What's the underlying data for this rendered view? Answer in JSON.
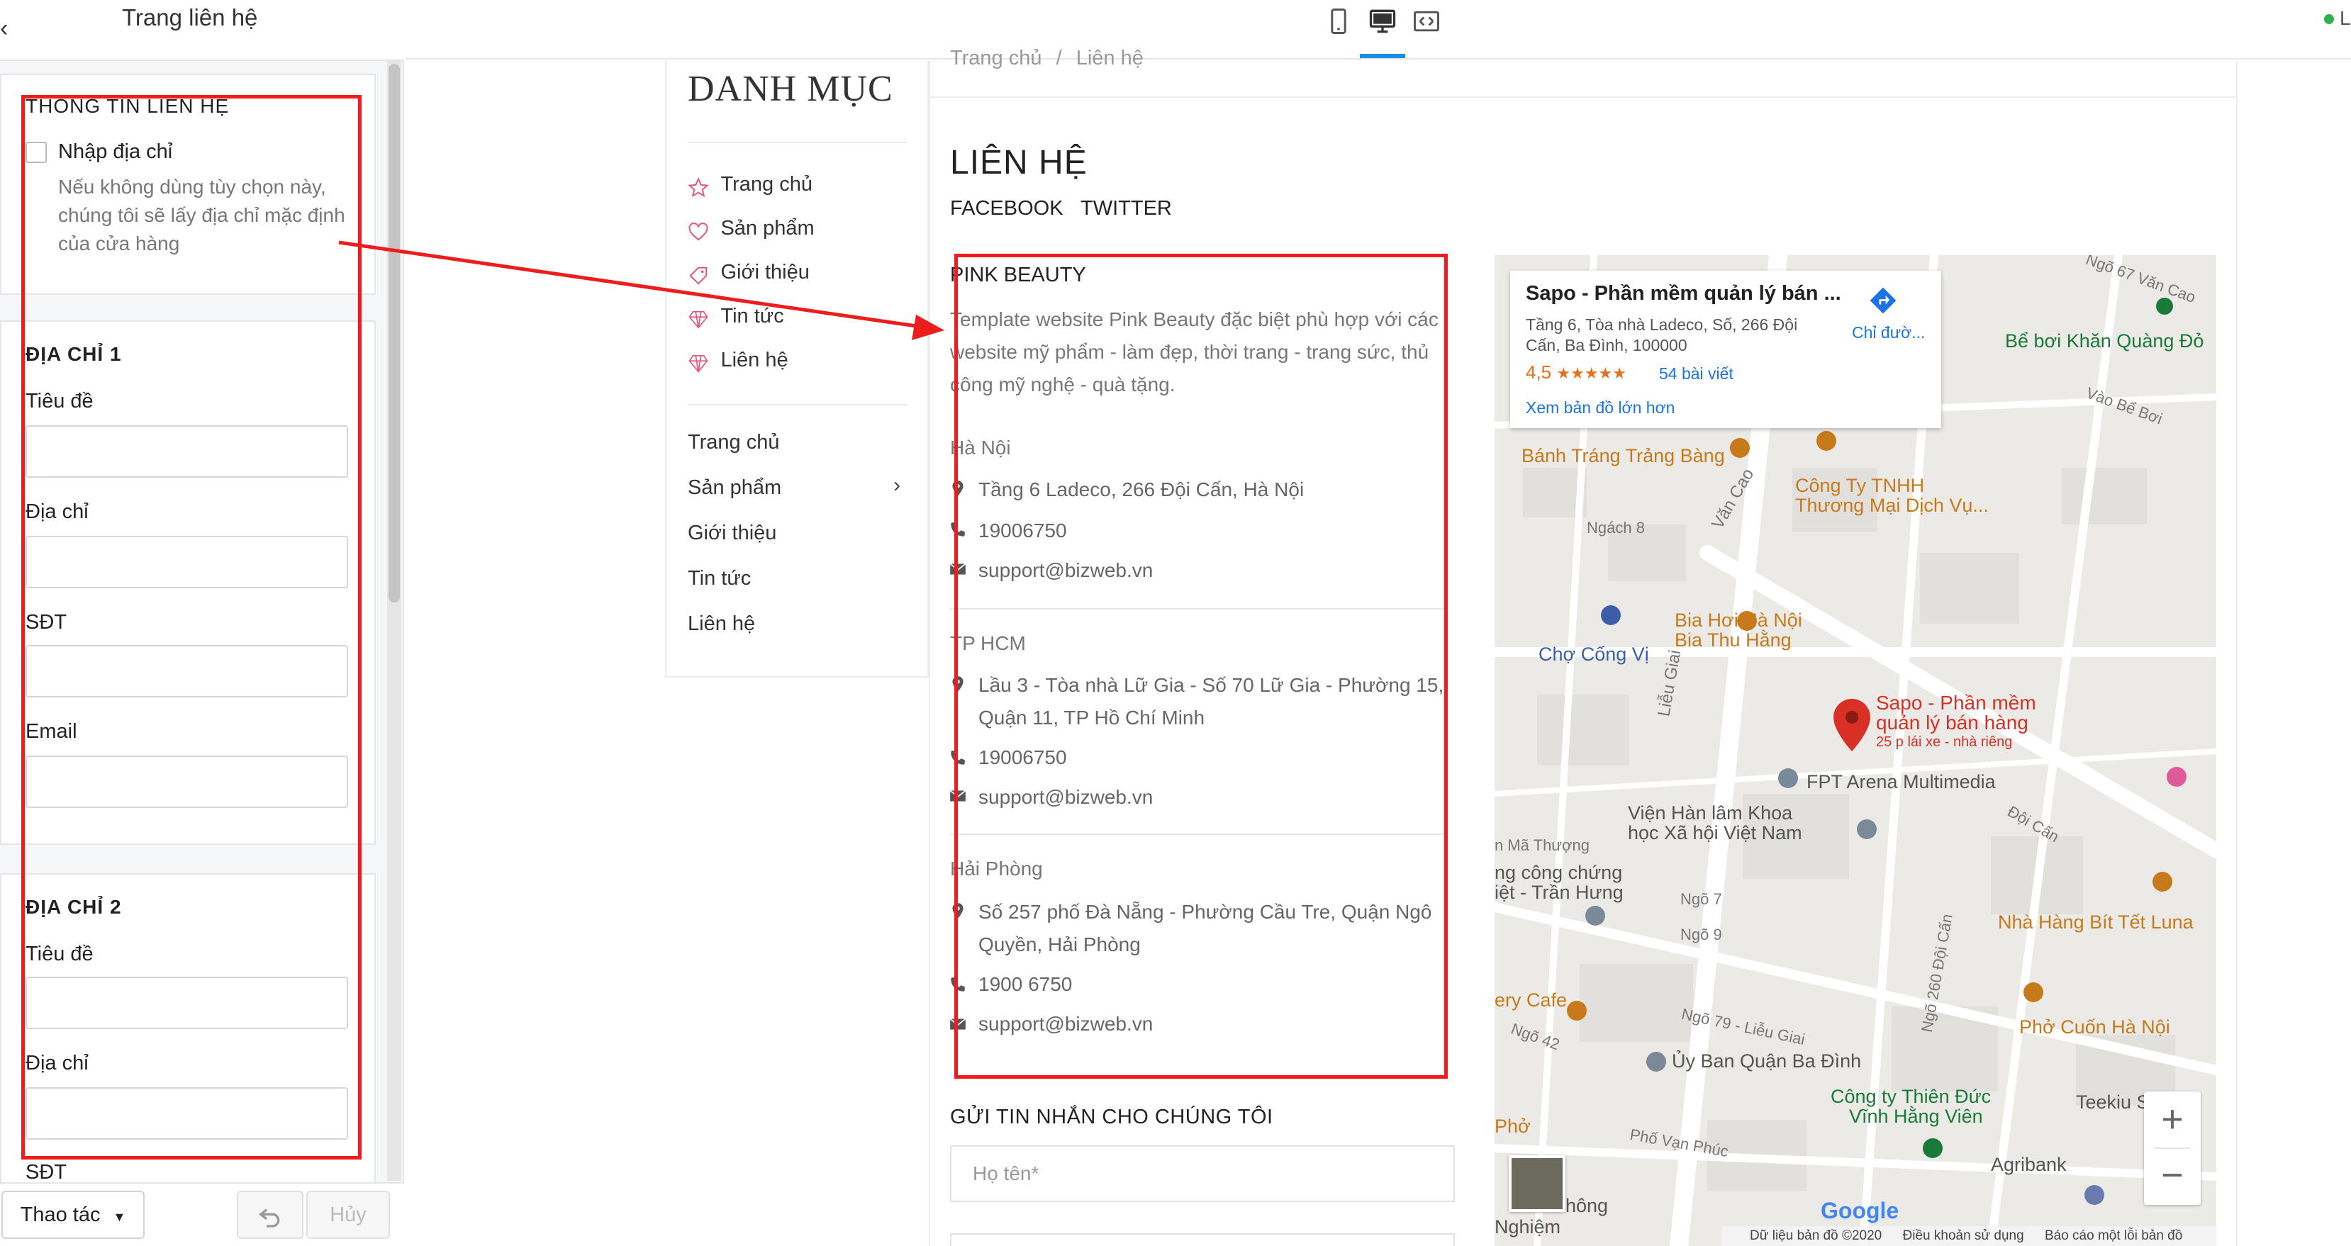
{
  "left_panel": {
    "title": "Trang liên hệ",
    "contact_section": {
      "heading": "THÔNG TIN LIÊN HỆ",
      "checkbox_label": "Nhập địa chỉ",
      "help_text": "Nếu không dùng tùy chọn này, chúng tôi sẽ lấy địa chỉ mặc định của cửa hàng"
    },
    "address1": {
      "heading": "ĐỊA CHỈ 1",
      "fields": [
        "Tiêu đề",
        "Địa chỉ",
        "SĐT",
        "Email"
      ]
    },
    "address2": {
      "heading": "ĐỊA CHỈ 2",
      "fields": [
        "Tiêu đề",
        "Địa chỉ",
        "SĐT"
      ]
    },
    "footer": {
      "actions_label": "Thao tác",
      "cancel_label": "Hủy"
    }
  },
  "top_bar": {
    "status_text": "L"
  },
  "sidebar": {
    "title": "DANH MỤC",
    "icon_items": [
      {
        "label": "Trang chủ",
        "icon": "star-icon"
      },
      {
        "label": "Sản phẩm",
        "icon": "heart-icon"
      },
      {
        "label": "Giới thiệu",
        "icon": "tag-icon"
      },
      {
        "label": "Tin tức",
        "icon": "diamond-icon"
      },
      {
        "label": "Liên hệ",
        "icon": "diamond-icon"
      }
    ],
    "menu_items": [
      "Trang chủ",
      "Sản phẩm",
      "Giới thiệu",
      "Tin tức",
      "Liên hệ"
    ]
  },
  "content": {
    "breadcrumb": {
      "home": "Trang chủ",
      "sep": "/",
      "current": "Liên hệ"
    },
    "heading": "LIÊN HỆ",
    "social": [
      "FACEBOOK",
      "TWITTER"
    ],
    "store_name": "PINK BEAUTY",
    "store_desc": "Template website Pink Beauty đặc biệt phù hợp với các website mỹ phẩm - làm đẹp, thời trang - trang sức, thủ công mỹ nghệ - quà tặng.",
    "branches": [
      {
        "city": "Hà Nội",
        "address": "Tầng 6 Ladeco, 266 Đội Cấn, Hà Nội",
        "phone": "19006750",
        "email": "support@bizweb.vn"
      },
      {
        "city": "TP HCM",
        "address": "Lầu 3 - Tòa nhà Lữ Gia - Số 70 Lữ Gia - Phường 15, Quận 11, TP Hồ Chí Minh",
        "phone": "19006750",
        "email": "support@bizweb.vn"
      },
      {
        "city": "Hải Phòng",
        "address": "Số 257 phố Đà Nẵng - Phường Cầu Tre, Quận Ngô Quyền, Hải Phòng",
        "phone": "1900 6750",
        "email": "support@bizweb.vn"
      }
    ],
    "form_heading": "GỬI TIN NHẮN CHO CHÚNG TÔI",
    "name_placeholder": "Họ tên*"
  },
  "map": {
    "card_title": "Sapo - Phần mềm quản lý bán ...",
    "card_address": "Tầng 6, Tòa nhà Ladeco, Số, 266 Đội Cấn, Ba Đình, 100000",
    "rating": "4,5",
    "stars": "★★★★★",
    "rating_value": 4.5,
    "reviews": "54 bài viết",
    "directions": "Chỉ đườ...",
    "larger_map": "Xem bản đồ lớn hơn",
    "labels": [
      {
        "text": "Bể bơi Khăn Quàng Đỏ",
        "color": "#1a7a3a"
      },
      {
        "text": "Bánh Tráng Trảng Bàng",
        "color": "#c77a1c"
      },
      {
        "text": "Công Ty TNHH",
        "color": "#c77a1c"
      },
      {
        "text": "Thương Mại Dịch Vụ...",
        "color": "#c77a1c"
      },
      {
        "text": "Bia Hơi Hà Nội",
        "color": "#c77a1c"
      },
      {
        "text": "Bia Thu Hằng",
        "color": "#c77a1c"
      },
      {
        "text": "Chợ Cống Vị",
        "color": "#3a5fa8"
      },
      {
        "text": "Sapo - Phần mềm",
        "color": "#d93025"
      },
      {
        "text": "quản lý bán hàng",
        "color": "#d93025"
      },
      {
        "text": "25 p lái xe - nhà riêng",
        "color": "#d93025"
      },
      {
        "text": "FPT Arena Multimedia",
        "color": "#555"
      },
      {
        "text": "Viện Hàn lâm Khoa",
        "color": "#555"
      },
      {
        "text": "học Xã hội Việt Nam",
        "color": "#555"
      },
      {
        "text": "ng công chứng",
        "color": "#555"
      },
      {
        "text": "iệt - Trần Hưng",
        "color": "#555"
      },
      {
        "text": "Nhà Hàng Bít Tết Luna",
        "color": "#c77a1c"
      },
      {
        "text": "ery Cafe",
        "color": "#c77a1c"
      },
      {
        "text": "Phở Cuốn Hà Nội",
        "color": "#c77a1c"
      },
      {
        "text": "Ủy Ban Quận Ba Đình",
        "color": "#555"
      },
      {
        "text": "Công ty Thiên Đức",
        "color": "#1a7a3a"
      },
      {
        "text": "Vĩnh Hằng Viên",
        "color": "#1a7a3a"
      },
      {
        "text": "Teekiu S",
        "color": "#555"
      },
      {
        "text": "Agribank",
        "color": "#555"
      },
      {
        "text": "Phở",
        "color": "#c77a1c"
      },
      {
        "text": "hông",
        "color": "#555"
      },
      {
        "text": "Nghiệm",
        "color": "#555"
      }
    ],
    "street_labels": [
      "Văn Cao",
      "Liễu Giai",
      "Ngách 8",
      "Vào Bể Bơi",
      "Ngõ 67 Văn Cao",
      "Đội Cấn",
      "Ngõ 260 Đội Cấn",
      "Ngõ 7",
      "Ngõ 9",
      "Ngõ 79 - Liễu Giai",
      "Phố Vạn Phúc",
      "Ngõ 42",
      "n Mã Thượng"
    ],
    "google": "Google",
    "footer_data": "Dữ liệu bản đồ ©2020",
    "footer_terms": "Điều khoản sử dụng",
    "footer_report": "Báo cáo một lỗi bản đồ"
  },
  "colors": {
    "annotation": "#ee1c1c",
    "active_device": "#1a8ee6",
    "map_pin": "#d93025"
  }
}
